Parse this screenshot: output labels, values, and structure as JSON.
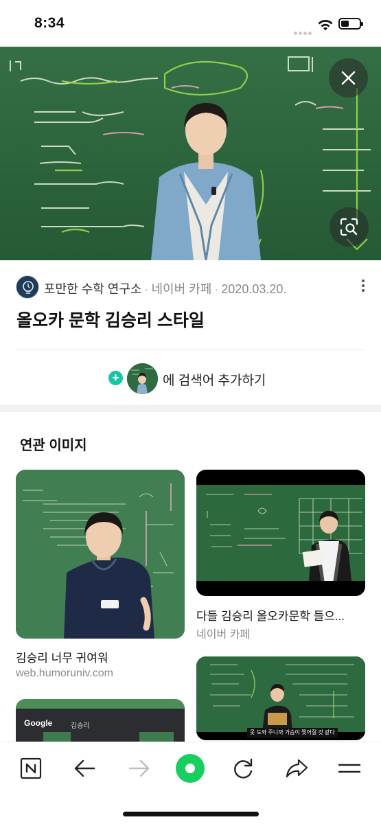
{
  "status_bar": {
    "time": "8:34"
  },
  "source": {
    "name": "포만한 수학 연구소",
    "platform": "네이버 카페",
    "date": "2020.03.20."
  },
  "title": "올오카 문학 김승리 스타일",
  "add_search": {
    "label": "에 검색어 추가하기"
  },
  "related": {
    "title": "연관 이미지",
    "items": [
      {
        "caption": "김승리 너무 귀여워",
        "source": "web.humoruniv.com"
      },
      {
        "caption": "다들 김승리 올오카문학 들으...",
        "source": "네이버 카페"
      },
      {
        "caption": "",
        "source": ""
      },
      {
        "caption": "",
        "source": ""
      }
    ],
    "google_thumb_text": "Google",
    "google_thumb_query": "김승리",
    "video_subtitle": "못 도와 주니까 가슴이 찢어질 것 같다"
  },
  "colors": {
    "accent_green": "#12c7a4",
    "naver_green": "#19ce60",
    "chalkboard": "#2d6b3f"
  }
}
